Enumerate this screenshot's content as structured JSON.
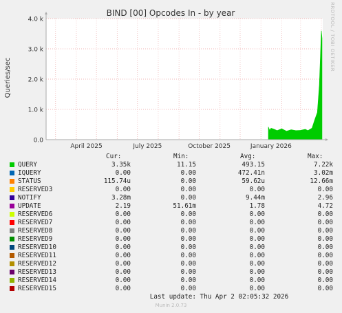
{
  "chart_data": {
    "type": "area",
    "title": "BIND [00] Opcodes In - by year",
    "ylabel": "Queries/sec",
    "ylim": [
      0,
      4000
    ],
    "yticks": [
      "0.0",
      "1.0 k",
      "2.0 k",
      "3.0 k",
      "4.0 k"
    ],
    "xticks": [
      "April 2025",
      "July 2025",
      "October 2025",
      "January 2026"
    ],
    "grid": true,
    "series": [
      {
        "name": "QUERY",
        "color": "#00cc00",
        "x": [
          "2026-01-12",
          "2026-01-14",
          "2026-01-16",
          "2026-01-20",
          "2026-01-25",
          "2026-02-01",
          "2026-02-08",
          "2026-02-15",
          "2026-02-22",
          "2026-03-01",
          "2026-03-08",
          "2026-03-12",
          "2026-03-18",
          "2026-03-22",
          "2026-03-26",
          "2026-03-29",
          "2026-04-01",
          "2026-04-02"
        ],
        "values": [
          420,
          310,
          380,
          350,
          300,
          360,
          280,
          330,
          300,
          310,
          340,
          300,
          380,
          650,
          900,
          1800,
          3600,
          3350
        ]
      }
    ]
  },
  "legend": {
    "headers": {
      "cur": "Cur:",
      "min": "Min:",
      "avg": "Avg:",
      "max": "Max:"
    },
    "rows": [
      {
        "name": "QUERY",
        "color": "#00cc00",
        "cur": "3.35k",
        "min": "11.15",
        "avg": "493.15",
        "max": "7.22k"
      },
      {
        "name": "IQUERY",
        "color": "#0066b3",
        "cur": "0.00",
        "min": "0.00",
        "avg": "472.41n",
        "max": "3.02m"
      },
      {
        "name": "STATUS",
        "color": "#ff8000",
        "cur": "115.74u",
        "min": "0.00",
        "avg": "59.62u",
        "max": "12.66m"
      },
      {
        "name": "RESERVED3",
        "color": "#ffcc00",
        "cur": "0.00",
        "min": "0.00",
        "avg": "0.00",
        "max": "0.00"
      },
      {
        "name": "NOTIFY",
        "color": "#330099",
        "cur": "3.28m",
        "min": "0.00",
        "avg": "9.44m",
        "max": "2.96"
      },
      {
        "name": "UPDATE",
        "color": "#990099",
        "cur": "2.19",
        "min": "51.61m",
        "avg": "1.78",
        "max": "4.72"
      },
      {
        "name": "RESERVED6",
        "color": "#ccff00",
        "cur": "0.00",
        "min": "0.00",
        "avg": "0.00",
        "max": "0.00"
      },
      {
        "name": "RESERVED7",
        "color": "#ff0000",
        "cur": "0.00",
        "min": "0.00",
        "avg": "0.00",
        "max": "0.00"
      },
      {
        "name": "RESERVED8",
        "color": "#808080",
        "cur": "0.00",
        "min": "0.00",
        "avg": "0.00",
        "max": "0.00"
      },
      {
        "name": "RESERVED9",
        "color": "#008f00",
        "cur": "0.00",
        "min": "0.00",
        "avg": "0.00",
        "max": "0.00"
      },
      {
        "name": "RESERVED10",
        "color": "#00487d",
        "cur": "0.00",
        "min": "0.00",
        "avg": "0.00",
        "max": "0.00"
      },
      {
        "name": "RESERVED11",
        "color": "#b35a00",
        "cur": "0.00",
        "min": "0.00",
        "avg": "0.00",
        "max": "0.00"
      },
      {
        "name": "RESERVED12",
        "color": "#b38f00",
        "cur": "0.00",
        "min": "0.00",
        "avg": "0.00",
        "max": "0.00"
      },
      {
        "name": "RESERVED13",
        "color": "#6b006b",
        "cur": "0.00",
        "min": "0.00",
        "avg": "0.00",
        "max": "0.00"
      },
      {
        "name": "RESERVED14",
        "color": "#8fb300",
        "cur": "0.00",
        "min": "0.00",
        "avg": "0.00",
        "max": "0.00"
      },
      {
        "name": "RESERVED15",
        "color": "#b30000",
        "cur": "0.00",
        "min": "0.00",
        "avg": "0.00",
        "max": "0.00"
      }
    ]
  },
  "footer": {
    "last_update": "Last update: Thu Apr  2 02:05:32 2026",
    "munin": "Munin 2.0.73",
    "rrdtool": "RRDTOOL / TOBI OETIKER"
  }
}
